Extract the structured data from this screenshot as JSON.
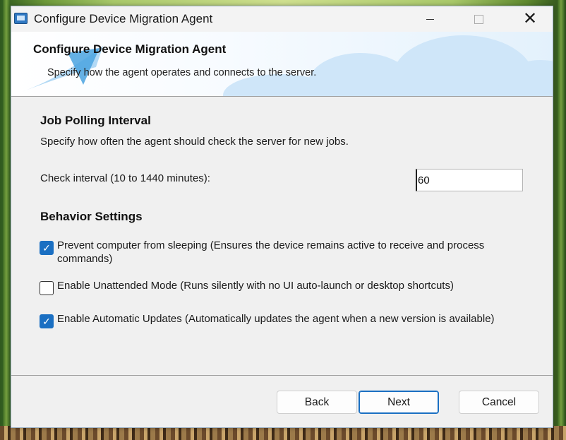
{
  "window": {
    "title": "Configure Device Migration Agent",
    "controls": {
      "minimize": "minimize",
      "maximize": "maximize",
      "close": "✕"
    }
  },
  "banner": {
    "title": "Configure Device Migration Agent",
    "subtitle": "Specify how the agent operates and connects to the server."
  },
  "polling": {
    "heading": "Job Polling Interval",
    "description": "Specify how often the agent should check the server for new jobs.",
    "interval_label": "Check interval (10 to 1440 minutes):",
    "interval_value": "60"
  },
  "behavior": {
    "heading": "Behavior Settings",
    "options": [
      {
        "label": "Prevent computer from sleeping (Ensures the device remains active to receive and process commands)",
        "checked": true
      },
      {
        "label": "Enable Unattended Mode (Runs silently with no UI auto-launch or desktop shortcuts)",
        "checked": false
      },
      {
        "label": "Enable Automatic Updates (Automatically updates the agent when a new version is available)",
        "checked": true
      }
    ]
  },
  "buttons": {
    "back": "Back",
    "next": "Next",
    "cancel": "Cancel"
  },
  "colors": {
    "accent": "#1a6fc2",
    "dialog_bg": "#f0f0f0"
  }
}
